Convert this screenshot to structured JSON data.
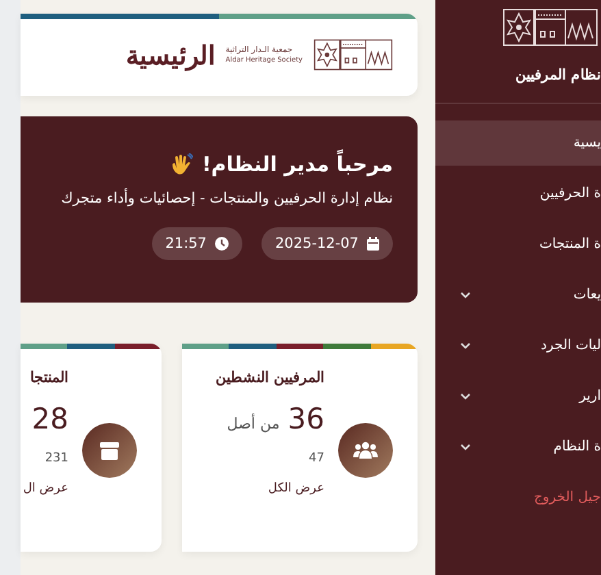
{
  "header": {
    "org_name_ar": "جمعية الـدار التراثية",
    "org_name_en": "Aldar Heritage Society",
    "title": "الرئيسية"
  },
  "welcome": {
    "title": "مرحباً مدير النظام!",
    "subtitle": "نظام إدارة الحرفيين والمنتجات - إحصائيات وأداء متجرك",
    "date": "2025-12-07",
    "time": "21:57"
  },
  "stat_cards": [
    {
      "title": "المرفيين النشطين",
      "value": "36",
      "suffix": "من أصل",
      "total": "47",
      "link": "عرض الكل"
    },
    {
      "title": "المنتجا",
      "value": "28",
      "total": "231",
      "link": "عرض ال"
    }
  ],
  "sidebar": {
    "title": "نظام المرفيين",
    "items": [
      {
        "label": "يسية",
        "selected": true,
        "expandable": false,
        "kind": "link"
      },
      {
        "label": "ة الحرفيين",
        "selected": false,
        "expandable": false,
        "kind": "link"
      },
      {
        "label": "ة المنتجات",
        "selected": false,
        "expandable": false,
        "kind": "link"
      },
      {
        "label": "يعات",
        "selected": false,
        "expandable": true,
        "kind": "link"
      },
      {
        "label": "ليات الجرد",
        "selected": false,
        "expandable": true,
        "kind": "link"
      },
      {
        "label": "ارير",
        "selected": false,
        "expandable": true,
        "kind": "link"
      },
      {
        "label": "ة النظام",
        "selected": false,
        "expandable": true,
        "kind": "link"
      },
      {
        "label": "جيل الخروج",
        "selected": false,
        "expandable": false,
        "kind": "logout"
      }
    ]
  }
}
